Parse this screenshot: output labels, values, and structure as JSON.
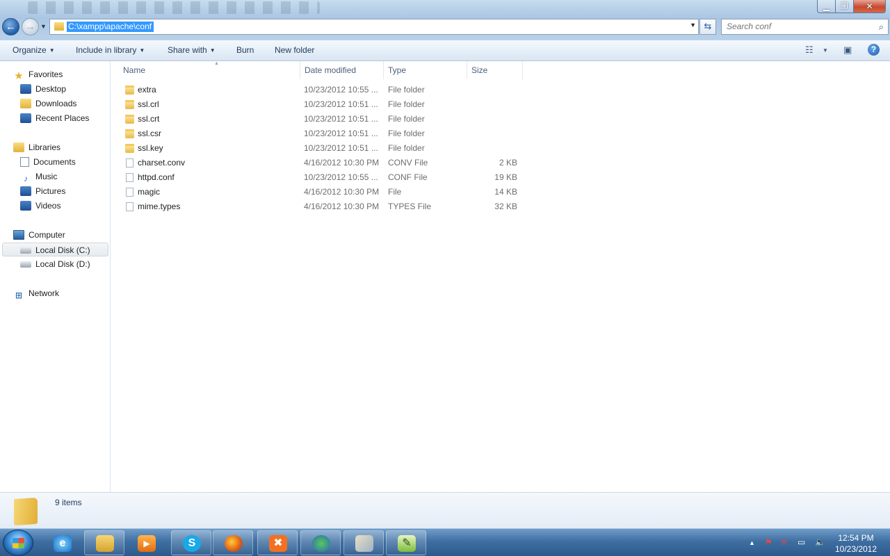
{
  "window": {
    "controls": {
      "minimize": "▁",
      "maximize": "❐",
      "close": "✕"
    }
  },
  "address": {
    "path": "C:\\xampp\\apache\\conf"
  },
  "search": {
    "placeholder": "Search conf"
  },
  "toolbar": {
    "organize": "Organize",
    "include_in_library": "Include in library",
    "share_with": "Share with",
    "burn": "Burn",
    "new_folder": "New folder"
  },
  "nav": {
    "favorites": {
      "label": "Favorites",
      "items": [
        "Desktop",
        "Downloads",
        "Recent Places"
      ]
    },
    "libraries": {
      "label": "Libraries",
      "items": [
        "Documents",
        "Music",
        "Pictures",
        "Videos"
      ]
    },
    "computer": {
      "label": "Computer",
      "items": [
        "Local Disk (C:)",
        "Local Disk (D:)"
      ],
      "selected": "Local Disk (C:)"
    },
    "network": {
      "label": "Network"
    }
  },
  "columns": {
    "name": "Name",
    "date_modified": "Date modified",
    "type": "Type",
    "size": "Size"
  },
  "files": [
    {
      "name": "extra",
      "date": "10/23/2012 10:55 ...",
      "type": "File folder",
      "size": "",
      "icon": "folder-icon"
    },
    {
      "name": "ssl.crl",
      "date": "10/23/2012 10:51 ...",
      "type": "File folder",
      "size": "",
      "icon": "folder-icon"
    },
    {
      "name": "ssl.crt",
      "date": "10/23/2012 10:51 ...",
      "type": "File folder",
      "size": "",
      "icon": "folder-icon"
    },
    {
      "name": "ssl.csr",
      "date": "10/23/2012 10:51 ...",
      "type": "File folder",
      "size": "",
      "icon": "folder-icon"
    },
    {
      "name": "ssl.key",
      "date": "10/23/2012 10:51 ...",
      "type": "File folder",
      "size": "",
      "icon": "folder-icon"
    },
    {
      "name": "charset.conv",
      "date": "4/16/2012 10:30 PM",
      "type": "CONV File",
      "size": "2 KB",
      "icon": "file-icon"
    },
    {
      "name": "httpd.conf",
      "date": "10/23/2012 10:55 ...",
      "type": "CONF File",
      "size": "19 KB",
      "icon": "file-icon"
    },
    {
      "name": "magic",
      "date": "4/16/2012 10:30 PM",
      "type": "File",
      "size": "14 KB",
      "icon": "file-icon"
    },
    {
      "name": "mime.types",
      "date": "4/16/2012 10:30 PM",
      "type": "TYPES File",
      "size": "32 KB",
      "icon": "file-icon"
    }
  ],
  "status": {
    "item_count": "9 items"
  },
  "taskbar": {
    "items": [
      "explorer-icon",
      "internet-explorer-icon",
      "media-player-icon",
      "skype-icon",
      "firefox-icon",
      "xampp-icon",
      "download-manager-icon",
      "paint-icon",
      "notepad-icon"
    ],
    "clock_time": "12:54 PM",
    "clock_date": "10/23/2012"
  },
  "colors": {
    "accent": "#3399ff",
    "title_bar": "#a9c6e3",
    "taskbar": "#3f6fa2",
    "folder": "#e8b943"
  }
}
